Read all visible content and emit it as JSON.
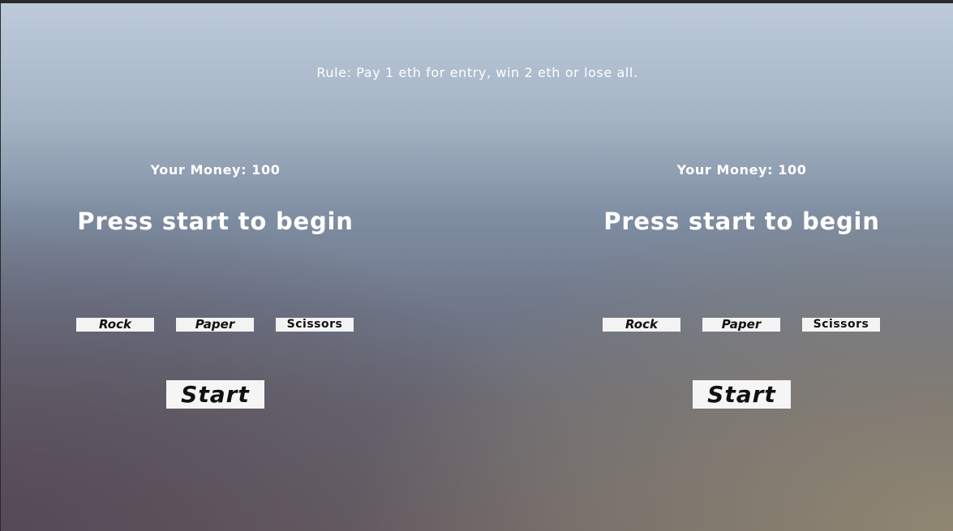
{
  "rule_text": "Rule: Pay 1 eth for entry, win 2 eth or lose all.",
  "players": [
    {
      "money_label": "Your Money: 100",
      "status": "Press start to begin",
      "choices": [
        "Rock",
        "Paper",
        "Scissors"
      ],
      "start_label": "Start"
    },
    {
      "money_label": "Your Money: 100",
      "status": "Press start to begin",
      "choices": [
        "Rock",
        "Paper",
        "Scissors"
      ],
      "start_label": "Start"
    }
  ],
  "colors": {
    "text": "#ffffff",
    "button_bg": "#f3f3f3",
    "button_text": "#111111"
  }
}
